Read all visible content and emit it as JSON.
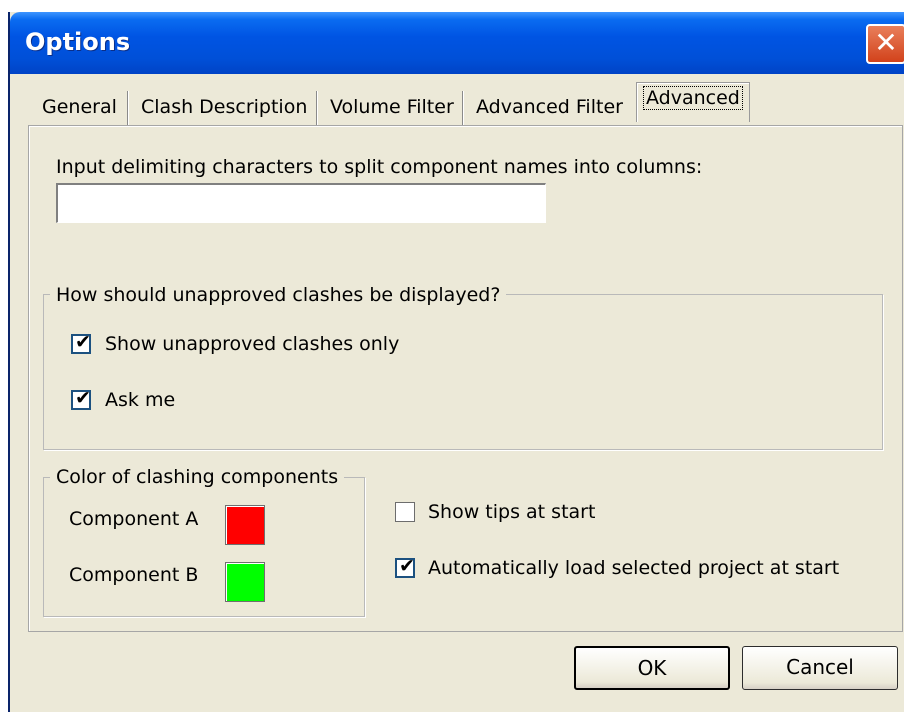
{
  "window": {
    "title": "Options"
  },
  "tabs": [
    {
      "label": "General"
    },
    {
      "label": "Clash Description"
    },
    {
      "label": "Volume Filter"
    },
    {
      "label": "Advanced Filter"
    },
    {
      "label": "Advanced"
    }
  ],
  "active_tab": "Advanced",
  "delimiter": {
    "label": "Input delimiting characters to split component names into columns:",
    "value": ""
  },
  "unapproved_group": {
    "legend": "How should unapproved clashes be displayed?",
    "options": [
      {
        "label": "Show unapproved clashes only",
        "checked": true
      },
      {
        "label": "Ask me",
        "checked": true
      }
    ]
  },
  "color_group": {
    "legend": "Color of clashing components",
    "components": [
      {
        "label": "Component A",
        "color": "#ff0000"
      },
      {
        "label": "Component B",
        "color": "#00ff00"
      }
    ]
  },
  "start_options": [
    {
      "label": "Show tips at start",
      "checked": false
    },
    {
      "label": "Automatically load selected project at start",
      "checked": true
    }
  ],
  "buttons": {
    "ok": "OK",
    "cancel": "Cancel"
  },
  "check_glyph": "✔"
}
